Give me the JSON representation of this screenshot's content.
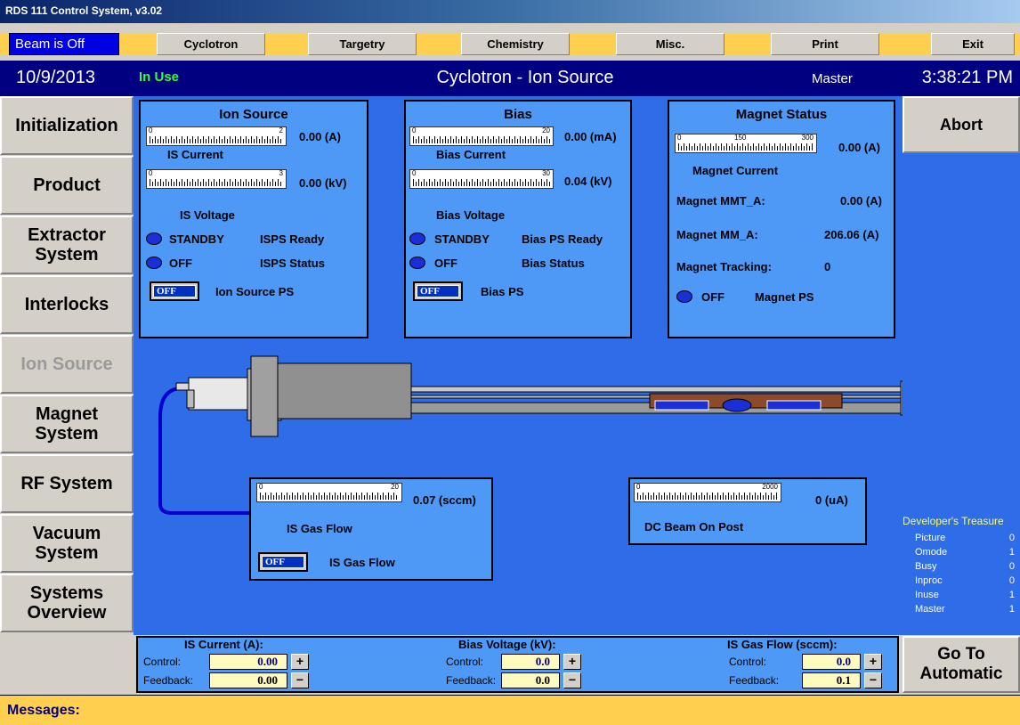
{
  "window": {
    "title": "RDS 111 Control System, v3.02"
  },
  "topmenu": {
    "beam_status": "Beam is Off",
    "items": [
      "Cyclotron",
      "Targetry",
      "Chemistry",
      "Misc.",
      "Print",
      "Exit"
    ]
  },
  "header": {
    "date": "10/9/2013",
    "in_use": "In Use",
    "title": "Cyclotron - Ion Source",
    "master": "Master",
    "time": "3:38:21 PM"
  },
  "nav": {
    "items": [
      "Initialization",
      "Product",
      "Extractor System",
      "Interlocks",
      "Ion Source",
      "Magnet System",
      "RF System",
      "Vacuum System",
      "Systems Overview"
    ]
  },
  "ion_source": {
    "title": "Ion Source",
    "current_gauge": {
      "min": "0",
      "max": "2",
      "value": "0.00 (A)",
      "label": "IS Current"
    },
    "voltage_gauge": {
      "min": "0",
      "max": "3",
      "value": "0.00 (kV)",
      "label": "IS Voltage"
    },
    "status1": {
      "state": "STANDBY",
      "label": "ISPS Ready"
    },
    "status2": {
      "state": "OFF",
      "label": "ISPS Status"
    },
    "toggle": {
      "state": "OFF",
      "label": "Ion Source PS"
    }
  },
  "bias": {
    "title": "Bias",
    "current_gauge": {
      "min": "0",
      "max": "20",
      "value": "0.00 (mA)",
      "label": "Bias Current"
    },
    "voltage_gauge": {
      "min": "0",
      "max": "30",
      "value": "0.04 (kV)",
      "label": "Bias Voltage"
    },
    "status1": {
      "state": "STANDBY",
      "label": "Bias PS Ready"
    },
    "status2": {
      "state": "OFF",
      "label": "Bias Status"
    },
    "toggle": {
      "state": "OFF",
      "label": "Bias PS"
    }
  },
  "magnet": {
    "title": "Magnet Status",
    "gauge": {
      "min": "0",
      "mid": "150",
      "max": "300",
      "value": "0.00 (A)",
      "label": "Magnet Current"
    },
    "mmt_a": {
      "label": "Magnet MMT_A:",
      "value": "0.00 (A)"
    },
    "mm_a": {
      "label": "Magnet MM_A:",
      "value": "206.06 (A)"
    },
    "tracking": {
      "label": "Magnet Tracking:",
      "value": "0"
    },
    "ps": {
      "state": "OFF",
      "label": "Magnet PS"
    }
  },
  "gas_flow": {
    "gauge": {
      "min": "0",
      "max": "20",
      "value": "0.07 (sccm)",
      "label": "IS Gas Flow"
    },
    "toggle": {
      "state": "OFF",
      "label": "IS Gas Flow"
    }
  },
  "dc_beam": {
    "gauge": {
      "min": "0",
      "max": "2000",
      "value": "0 (uA)",
      "label": "DC Beam On Post"
    }
  },
  "right": {
    "abort": "Abort",
    "go_auto": "Go To Automatic",
    "dev_title": "Developer's Treasure",
    "dev_rows": [
      {
        "k": "Picture",
        "v": "0"
      },
      {
        "k": "Omode",
        "v": "1"
      },
      {
        "k": "Busy",
        "v": "0"
      },
      {
        "k": "Inproc",
        "v": "0"
      },
      {
        "k": "Inuse",
        "v": "1"
      },
      {
        "k": "Master",
        "v": "1"
      }
    ]
  },
  "controls": {
    "control_label": "Control:",
    "feedback_label": "Feedback:",
    "groups": [
      {
        "title": "IS Current (A):",
        "control": "0.00",
        "feedback": "0.00"
      },
      {
        "title": "Bias Voltage (kV):",
        "control": "0.0",
        "feedback": "0.0"
      },
      {
        "title": "IS Gas Flow (sccm):",
        "control": "0.0",
        "feedback": "0.1"
      }
    ],
    "plus": "+",
    "minus": "−"
  },
  "messages": {
    "label": "Messages:"
  },
  "colors": {
    "panel": "#4d99f5",
    "background": "#2f6ce8",
    "header": "#000080",
    "menu": "#ffd050",
    "led": "#1a2fd6"
  }
}
